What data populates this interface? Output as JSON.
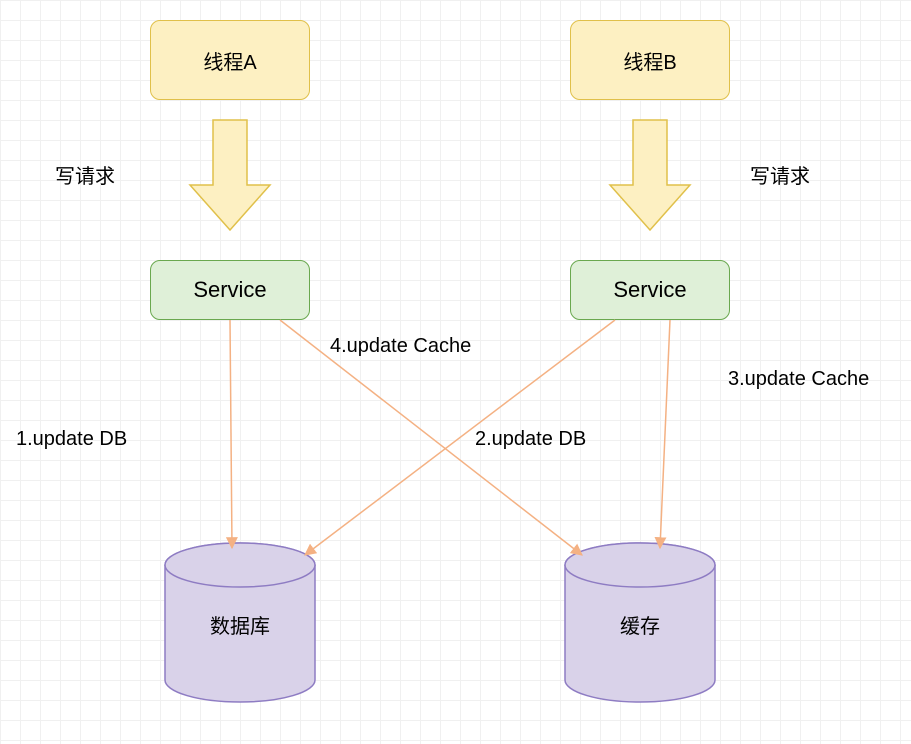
{
  "nodes": {
    "threadA": "线程A",
    "threadB": "线程B",
    "serviceA": "Service",
    "serviceB": "Service",
    "database": "数据库",
    "cache": "缓存"
  },
  "labels": {
    "writeReqA": "写请求",
    "writeReqB": "写请求",
    "step1": "1.update DB",
    "step2": "2.update DB",
    "step3": "3.update Cache",
    "step4": "4.update Cache"
  },
  "colors": {
    "yellowFill": "#fdf0c2",
    "yellowStroke": "#e0c04a",
    "greenFill": "#dff0d8",
    "greenStroke": "#6aa84f",
    "purpleFill": "#d9d2e9",
    "purpleStroke": "#8e7cc3",
    "arrowOrange": "#f4b183"
  }
}
